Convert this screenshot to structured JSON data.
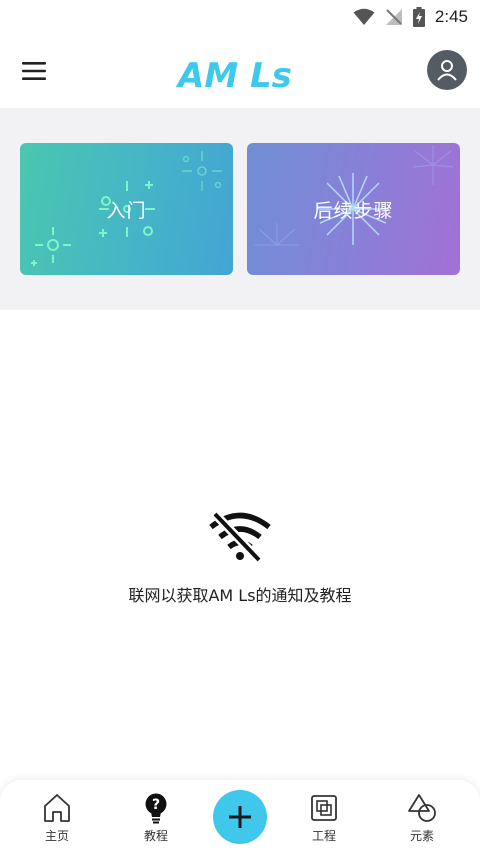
{
  "status_bar": {
    "time": "2:45"
  },
  "app_bar": {
    "logo_text": "AM Ls"
  },
  "cards": [
    {
      "label": "入门",
      "gradient": [
        "#4ac7b0",
        "#43a4d4"
      ]
    },
    {
      "label": "后续步骤",
      "gradient": [
        "#6f8ed6",
        "#a271d6"
      ]
    }
  ],
  "empty_state": {
    "icon": "wifi-off-icon",
    "message": "联网以获取AM Ls的通知及教程"
  },
  "bottom_nav": {
    "items": [
      {
        "label": "主页",
        "icon": "home-icon"
      },
      {
        "label": "教程",
        "icon": "lightbulb-help-icon"
      },
      {
        "label": "工程",
        "icon": "project-icon"
      },
      {
        "label": "元素",
        "icon": "shapes-icon"
      }
    ],
    "fab_icon": "plus-icon"
  },
  "colors": {
    "accent": "#3fc8ec",
    "logo": "#3cc9ea",
    "card_section_bg": "#f2f2f4",
    "avatar_bg": "#555b63"
  }
}
